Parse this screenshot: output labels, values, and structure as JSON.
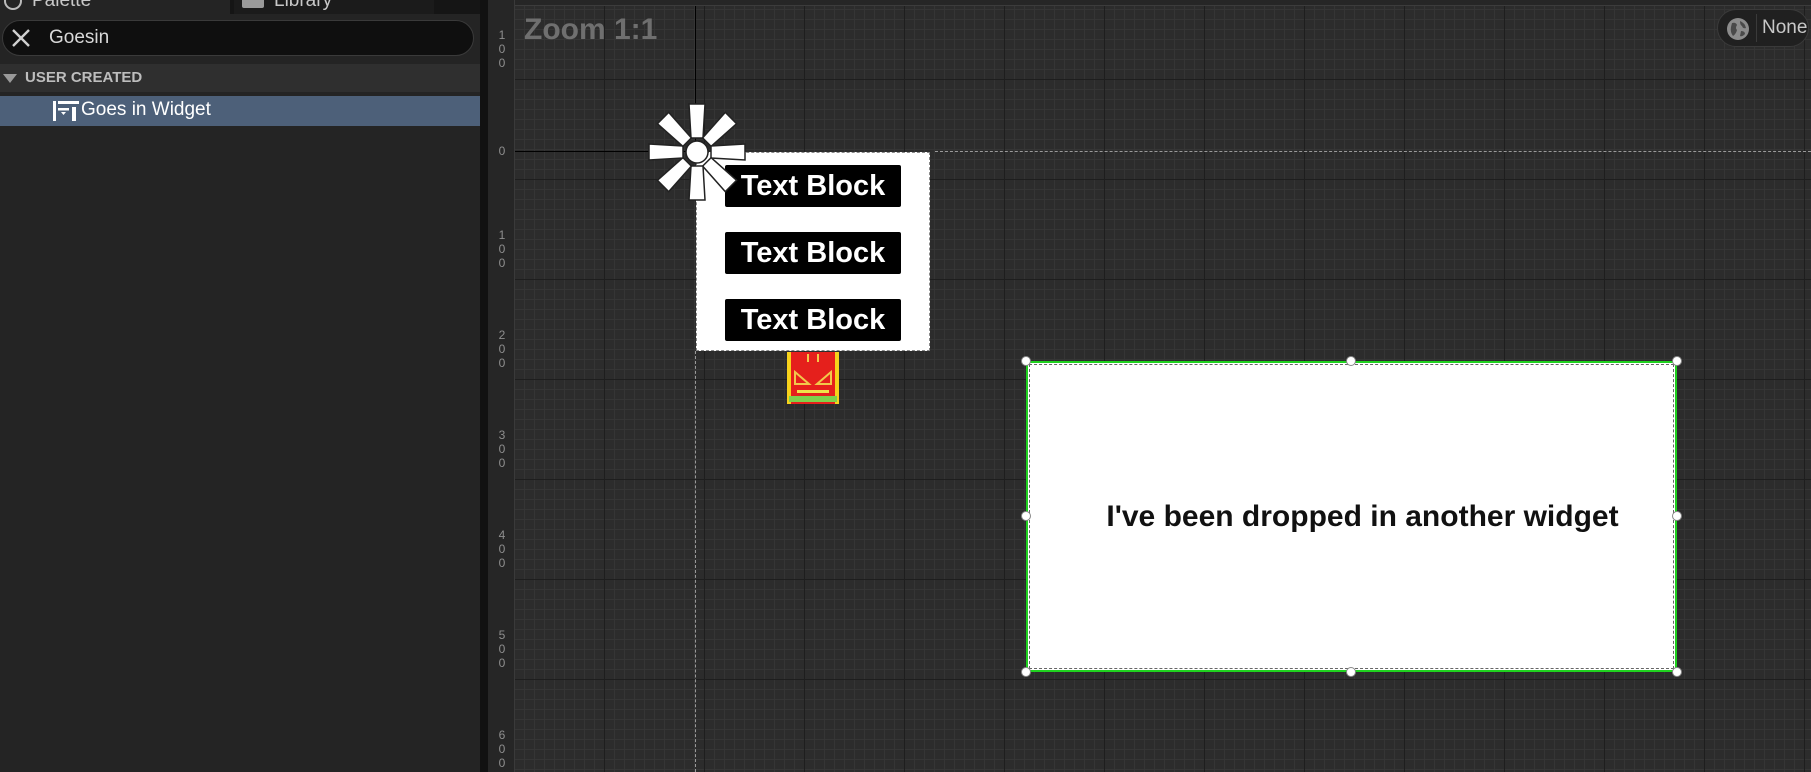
{
  "tabs": [
    {
      "label": "Palette"
    },
    {
      "label": "Library"
    }
  ],
  "search": {
    "value": "Goesin",
    "placeholder": ""
  },
  "palette": {
    "category": "USER CREATED",
    "items": [
      {
        "label": "Goes in Widget"
      }
    ]
  },
  "canvas": {
    "zoom_label": "Zoom 1:1",
    "world_button_label": "None",
    "ruler_marks": [
      "100",
      "0",
      "100",
      "200",
      "300",
      "400",
      "500",
      "600"
    ],
    "text_blocks": [
      "Text Block",
      "Text Block",
      "Text Block"
    ],
    "selected_widget_text": "I've been dropped in another widget"
  },
  "colors": {
    "selection_outline": "#1fd11f",
    "selected_row": "#4d6079",
    "canvas_bg": "#2c2c2c"
  }
}
